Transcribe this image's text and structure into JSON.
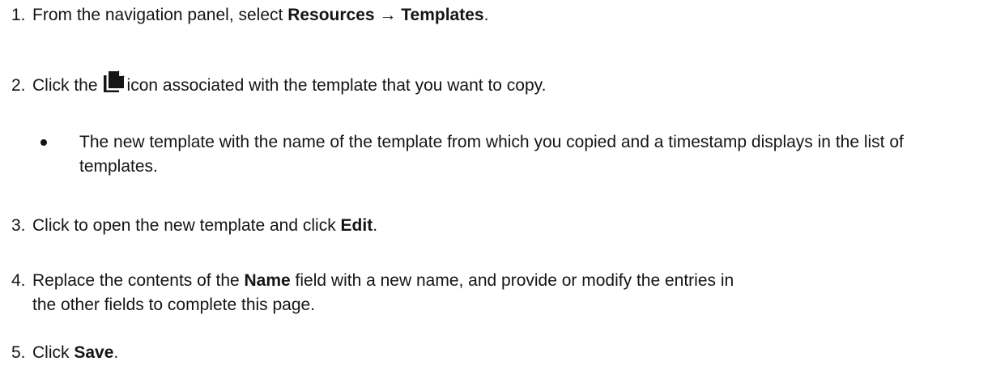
{
  "steps": [
    {
      "number": "1.",
      "before": "From the navigation panel, select ",
      "strong": "Resources → Templates",
      "after": "."
    },
    {
      "number": "2.",
      "before": "Click the",
      "icon": "copy-icon",
      "after": "icon associated with the template that you want to copy.",
      "bullet": "The new template with the name of the template from which you copied and a timestamp displays in the list of templates."
    },
    {
      "number": "3.",
      "before": "Click to open the new template and click ",
      "strong": "Edit",
      "after": "."
    },
    {
      "number": "4.",
      "before": "Replace the contents of the ",
      "strong": "Name",
      "after_line1": " field with a new name, and provide or modify the entries in",
      "after_line2": "the other fields to complete this page."
    },
    {
      "number": "5.",
      "before": "Click ",
      "strong": "Save",
      "after": "."
    }
  ]
}
